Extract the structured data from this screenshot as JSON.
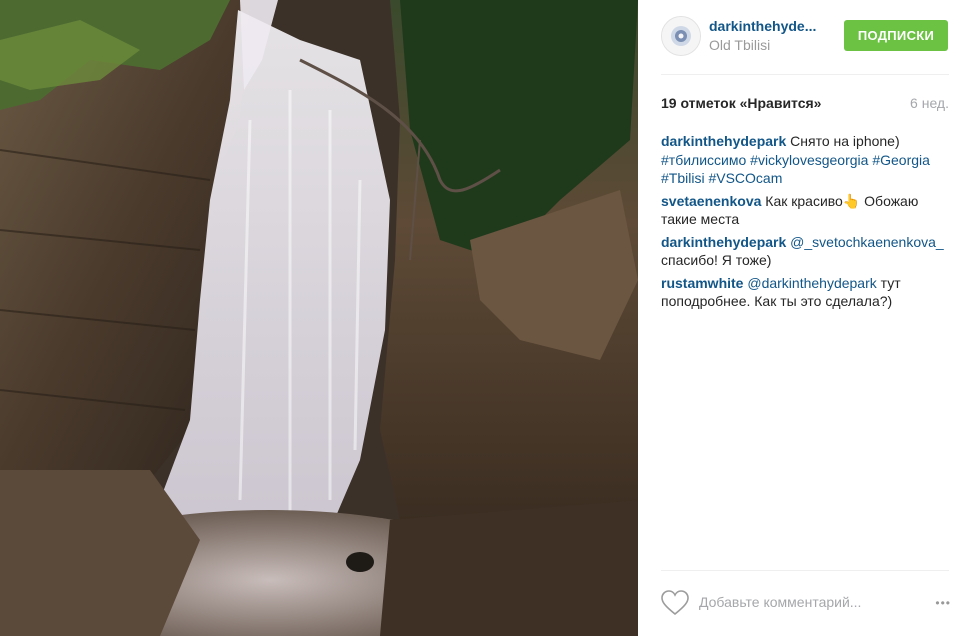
{
  "post": {
    "photo_subject": "waterfall-photo",
    "author": {
      "username": "darkinthehyde...",
      "location": "Old Tbilisi",
      "follow_label": "ПОДПИСКИ"
    },
    "likes_label": "19 отметок «Нравится»",
    "age_label": "6 нед.",
    "comments": [
      {
        "user": "darkinthehydepark",
        "text": " Снято на iphone) ",
        "tags": [
          "#тбилиссимо",
          "#vickylovesgeorgia",
          "#Georgia",
          "#Tbilisi",
          "#VSCOcam"
        ]
      },
      {
        "user": "svetaenenkova",
        "text": " Как красиво👆 Обожаю такие места"
      },
      {
        "user": "darkinthehydepark",
        "mention": " @_svetochkaenenkova_",
        "text": " спасибо! Я тоже)"
      },
      {
        "user": "rustamwhite",
        "mention": " @darkinthehydepark",
        "text": " тут поподробнее. Как ты это сделала?)"
      }
    ],
    "comment_placeholder": "Добавьте комментарий...",
    "more_label": "•••",
    "colors": {
      "username": "#125688",
      "follow": "#6bc243",
      "muted": "#a5a7aa"
    }
  }
}
